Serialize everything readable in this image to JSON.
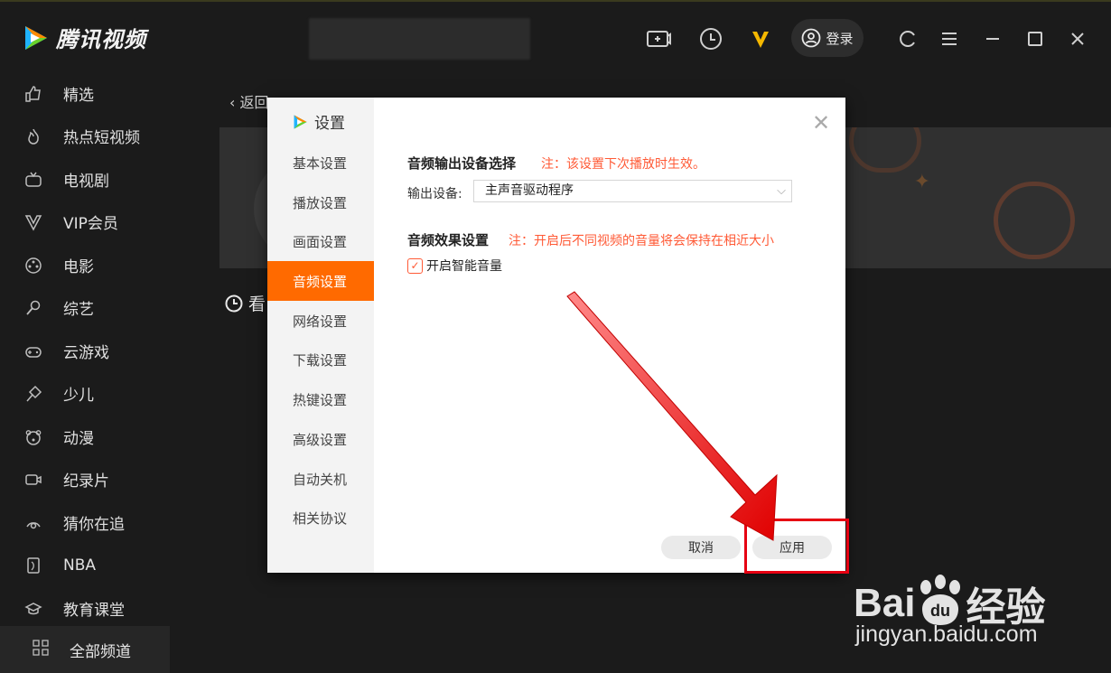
{
  "app": {
    "name": "腾讯视频",
    "brand_color": "#ff6a00"
  },
  "topbar": {
    "login_label": "登录",
    "icons": [
      "screen-record-icon",
      "history-clock-icon",
      "vip-icon",
      "refresh-icon",
      "menu-icon",
      "minimize-icon",
      "maximize-icon",
      "close-icon"
    ]
  },
  "sidebar": {
    "items": [
      {
        "label": "精选",
        "icon": "thumbs-up-icon"
      },
      {
        "label": "热点短视频",
        "icon": "flame-icon"
      },
      {
        "label": "电视剧",
        "icon": "tv-icon"
      },
      {
        "label": "VIP会员",
        "icon": "vip-icon"
      },
      {
        "label": "电影",
        "icon": "film-reel-icon"
      },
      {
        "label": "综艺",
        "icon": "microphone-icon"
      },
      {
        "label": "云游戏",
        "icon": "gamepad-icon"
      },
      {
        "label": "少儿",
        "icon": "kite-icon"
      },
      {
        "label": "动漫",
        "icon": "bear-face-icon"
      },
      {
        "label": "纪录片",
        "icon": "video-camera-icon"
      },
      {
        "label": "猜你在追",
        "icon": "eye-icon"
      },
      {
        "label": "NBA",
        "icon": "nba-icon"
      },
      {
        "label": "教育课堂",
        "icon": "graduation-cap-icon"
      }
    ],
    "all_channels": "全部频道"
  },
  "main": {
    "back_label": "返回",
    "history_label": "看"
  },
  "dialog": {
    "title": "设置",
    "tabs": [
      {
        "label": "基本设置"
      },
      {
        "label": "播放设置"
      },
      {
        "label": "画面设置"
      },
      {
        "label": "音频设置",
        "active": true
      },
      {
        "label": "网络设置"
      },
      {
        "label": "下载设置"
      },
      {
        "label": "热键设置"
      },
      {
        "label": "高级设置"
      },
      {
        "label": "自动关机"
      },
      {
        "label": "相关协议"
      }
    ],
    "output": {
      "section_title": "音频输出设备选择",
      "note": "注：该设置下次播放时生效。",
      "device_label": "输出设备:",
      "device_value": "主声音驱动程序"
    },
    "effect": {
      "section_title": "音频效果设置",
      "note": "注：开启后不同视频的音量将会保持在相近大小",
      "checkbox_label": "开启智能音量",
      "checked": true
    },
    "cancel_label": "取消",
    "apply_label": "应用"
  },
  "watermark": {
    "brand_a": "Bai",
    "brand_b": "经验",
    "domain": "jingyan.baidu.com"
  }
}
